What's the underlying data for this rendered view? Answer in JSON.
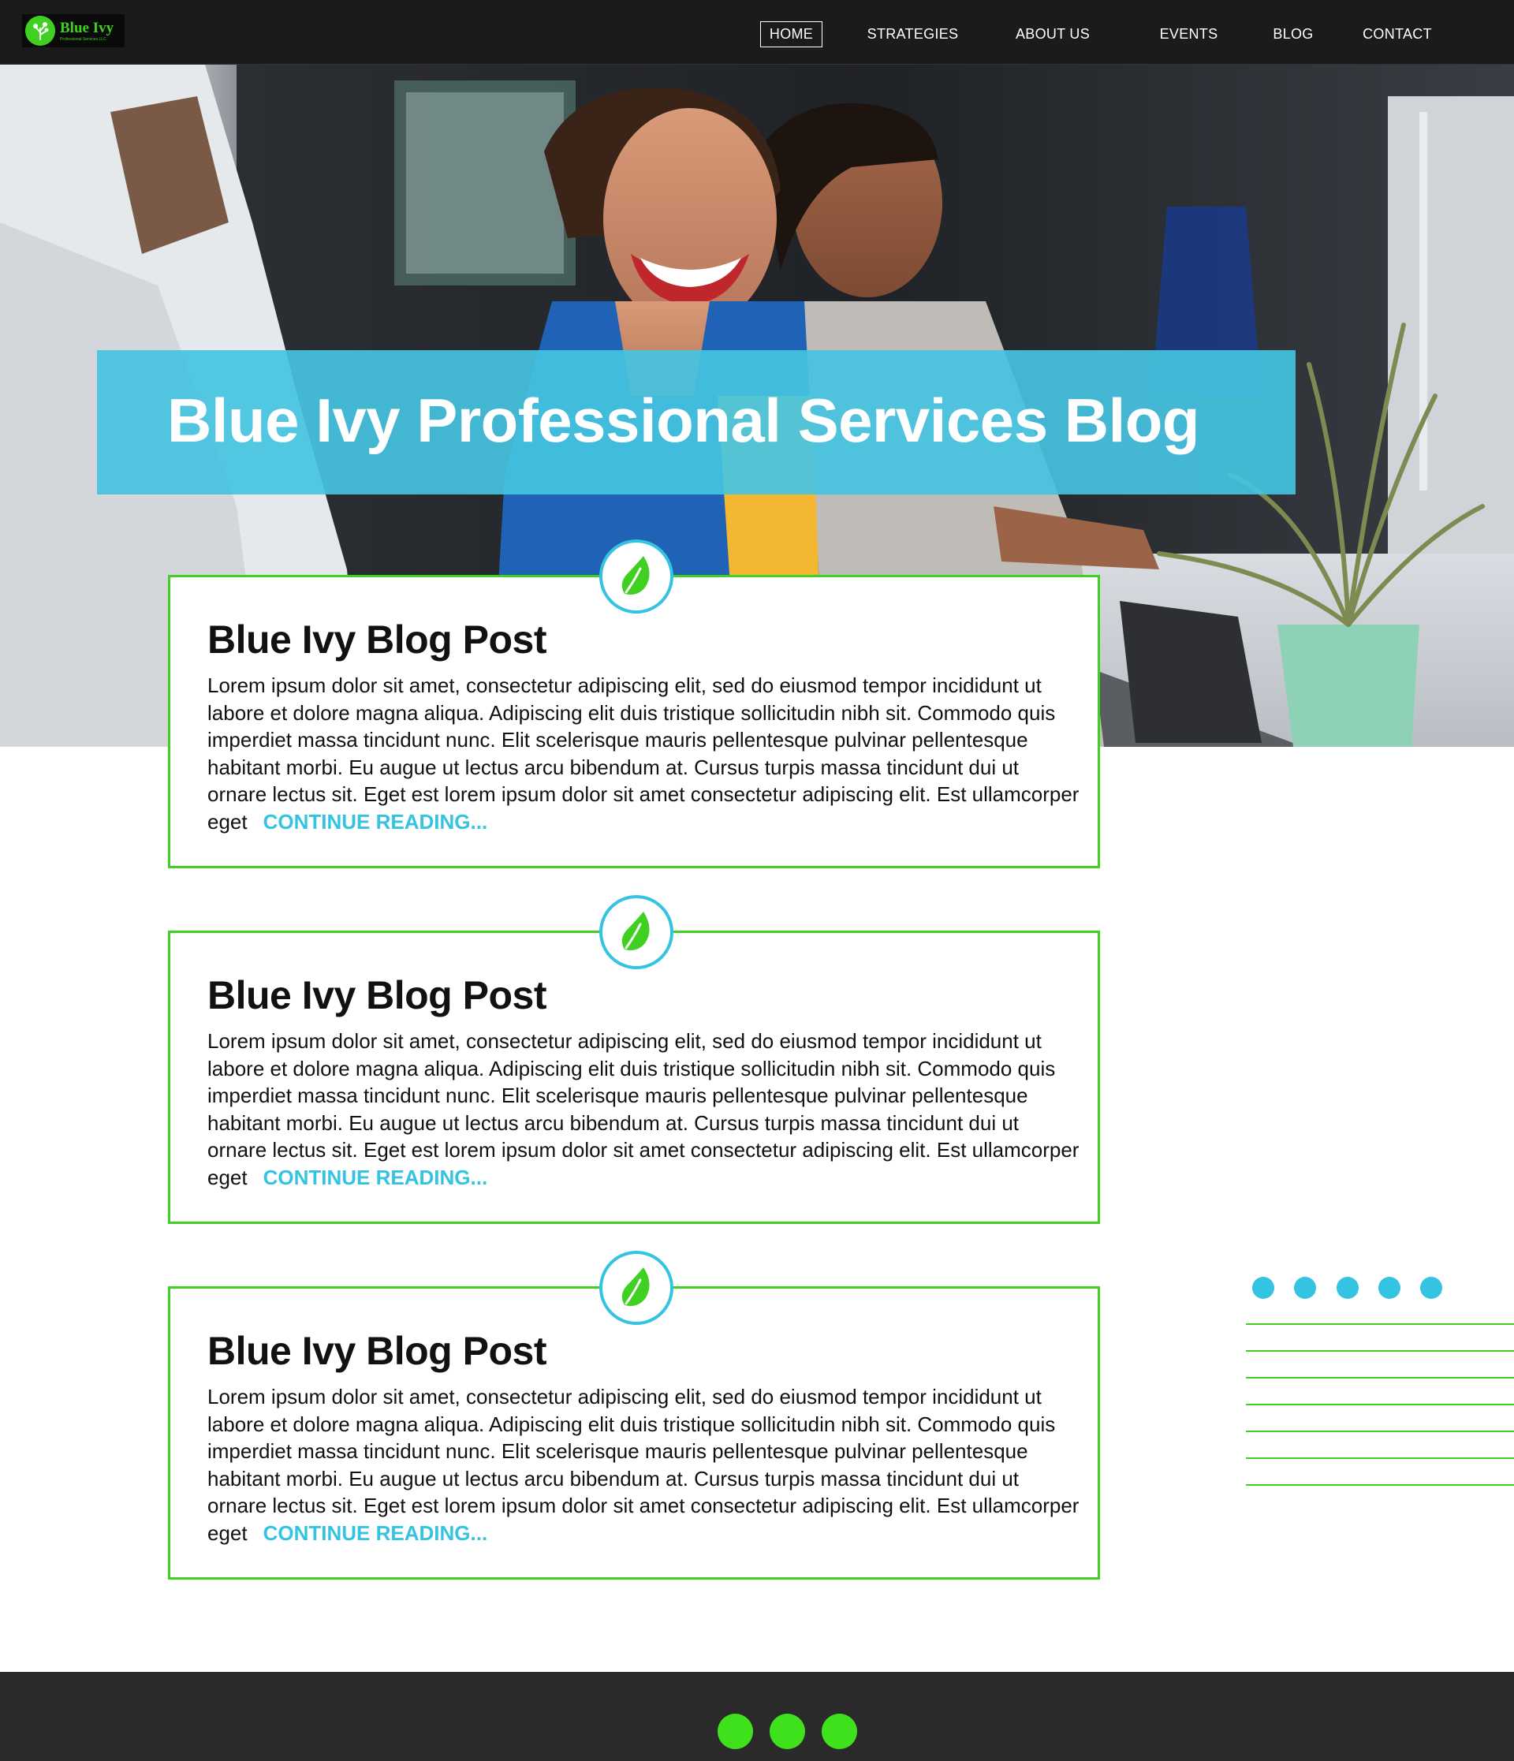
{
  "brand": {
    "name": "Blue Ivy",
    "tagline": "Professional Services LLC"
  },
  "nav": {
    "items": [
      {
        "label": "HOME",
        "active": true
      },
      {
        "label": "STRATEGIES",
        "active": false
      },
      {
        "label": "ABOUT US",
        "active": false
      },
      {
        "label": "EVENTS",
        "active": false
      },
      {
        "label": "BLOG",
        "active": false
      },
      {
        "label": "CONTACT",
        "active": false
      }
    ]
  },
  "hero": {
    "title": "Blue Ivy Professional Services Blog"
  },
  "posts": [
    {
      "title": "Blue Ivy Blog Post",
      "body": "Lorem ipsum dolor sit amet, consectetur adipiscing elit, sed do eiusmod tempor incididunt ut labore et dolore magna aliqua. Adipiscing elit duis tristique sollicitudin nibh sit. Commodo quis imperdiet massa tincidunt nunc. Elit scelerisque mauris pellentesque pulvinar pellentesque habitant morbi. Eu augue ut lectus arcu bibendum at. Cursus turpis massa tincidunt dui ut ornare lectus sit. Eget est lorem ipsum dolor sit amet consectetur adipiscing elit. Est ullamcorper eget",
      "link": "CONTINUE READING..."
    },
    {
      "title": "Blue Ivy Blog Post",
      "body": "Lorem ipsum dolor sit amet, consectetur adipiscing elit, sed do eiusmod tempor incididunt ut labore et dolore magna aliqua. Adipiscing elit duis tristique sollicitudin nibh sit. Commodo quis imperdiet massa tincidunt nunc. Elit scelerisque mauris pellentesque pulvinar pellentesque habitant morbi. Eu augue ut lectus arcu bibendum at. Cursus turpis massa tincidunt dui ut ornare lectus sit. Eget est lorem ipsum dolor sit amet consectetur adipiscing elit. Est ullamcorper eget",
      "link": "CONTINUE READING..."
    },
    {
      "title": "Blue Ivy Blog Post",
      "body": "Lorem ipsum dolor sit amet, consectetur adipiscing elit, sed do eiusmod tempor incididunt ut labore et dolore magna aliqua. Adipiscing elit duis tristique sollicitudin nibh sit. Commodo quis imperdiet massa tincidunt nunc. Elit scelerisque mauris pellentesque pulvinar pellentesque habitant morbi. Eu augue ut lectus arcu bibendum at. Cursus turpis massa tincidunt dui ut ornare lectus sit. Eget est lorem ipsum dolor sit amet consectetur adipiscing elit. Est ullamcorper eget",
      "link": "CONTINUE READING..."
    }
  ],
  "icons": {
    "post_badge": "leaf-icon",
    "logo": "tree-icon"
  },
  "colors": {
    "nav_bg": "#1b1b1b",
    "accent_blue": "#34c3e1",
    "accent_green": "#3fd022",
    "footer_bg": "#2a2a2a",
    "text": "#111111"
  }
}
